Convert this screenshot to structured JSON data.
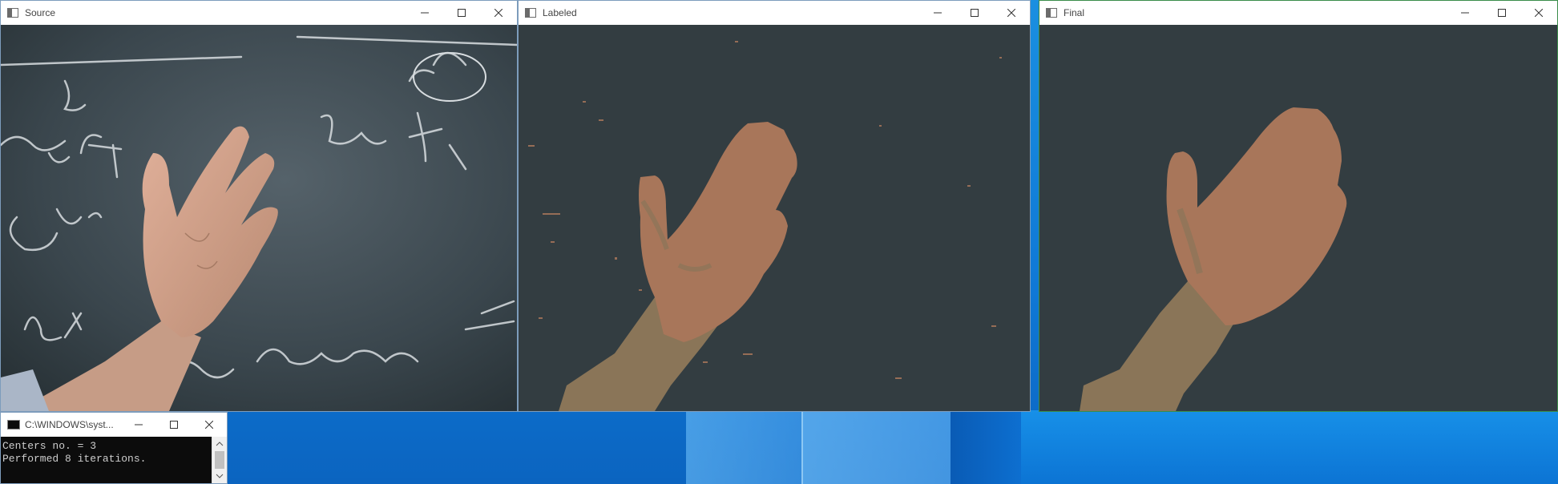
{
  "windows": {
    "source": {
      "title": "Source"
    },
    "labeled": {
      "title": "Labeled"
    },
    "final": {
      "title": "Final"
    },
    "console": {
      "title": "C:\\WINDOWS\\syst...",
      "lines": [
        "Centers no. = 3",
        "Performed 8 iterations."
      ]
    }
  },
  "controls": {
    "minimize": "—",
    "maximize": "☐",
    "close": "✕"
  },
  "colors": {
    "segment_background": "#333d41",
    "hand_segment": "#a8765a",
    "arm_segment": "#8a7558",
    "console_bg": "#0c0c0c",
    "desktop_blue": "#0f78d6"
  },
  "icons": [
    "app-icon",
    "minimize-icon",
    "maximize-icon",
    "close-icon",
    "console-icon",
    "scroll-up-icon",
    "scroll-down-icon"
  ]
}
